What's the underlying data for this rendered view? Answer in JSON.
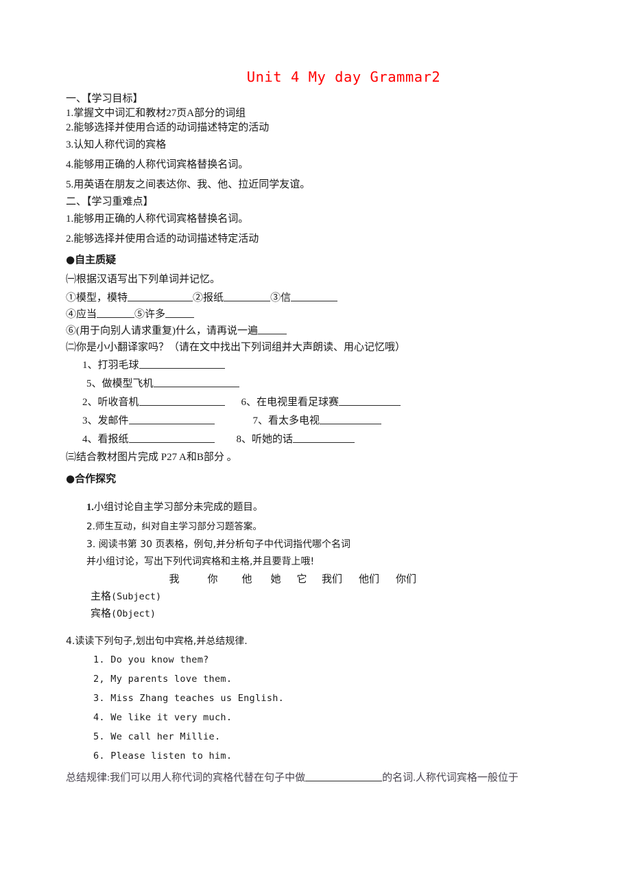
{
  "document": {
    "title": "Unit 4 My day Grammar2",
    "title_color": "#ff0000"
  },
  "section_objectives": {
    "heading": "一、【学习目标】",
    "items": [
      "1.掌握文中词汇和教材27页A部分的词组",
      "2.能够选择并使用合适的动词描述特定的活动",
      "3.认知人称代词的宾格",
      "4.能够用正确的人称代词宾格替换名词。",
      "5.用英语在朋友之间表达你、我、他、拉近同学友谊。"
    ]
  },
  "section_keypoints": {
    "heading": "二、【学习重难点】",
    "items": [
      "1.能够用正确的人称代词宾格替换名词。",
      "2.能够选择并使用合适的动词描述特定活动"
    ]
  },
  "section_selfquery": {
    "heading": "●自主质疑",
    "part1_label": "㈠根据汉语写出下列单词并记忆。",
    "part1_items": [
      {
        "num": "①",
        "text": "模型，模特",
        "blank": 95
      },
      {
        "num": "②",
        "text": "报纸",
        "blank": 68
      },
      {
        "num": "③",
        "text": "信",
        "blank": 68
      },
      {
        "num": "④",
        "text": "应当",
        "blank": 55
      },
      {
        "num": "⑤",
        "text": "许多",
        "blank": 42
      },
      {
        "num": "⑥",
        "text": "(用于向别人请求重复)什么，请再说一遍",
        "blank": 42
      }
    ],
    "part2_label": "㈡你是小小翻译家吗？（请在文中找出下列词组并大声朗读、用心记忆哦）",
    "part2_items": [
      {
        "num": "1、",
        "text": "打羽毛球",
        "blank": 125,
        "col": "left"
      },
      {
        "num": "5、",
        "text": "做模型飞机",
        "blank": 125,
        "col": "left"
      },
      {
        "num": "2、",
        "text": "听收音机",
        "blank": 125,
        "col": "left"
      },
      {
        "num": "6、",
        "text": "在电视里看足球赛",
        "blank": 90,
        "col": "right"
      },
      {
        "num": "3、",
        "text": "发邮件",
        "blank": 125,
        "col": "left"
      },
      {
        "num": "7、",
        "text": "看太多电视",
        "blank": 90,
        "col": "right"
      },
      {
        "num": "4、",
        "text": "看报纸",
        "blank": 125,
        "col": "left"
      },
      {
        "num": "8、",
        "text": "听她的话",
        "blank": 90,
        "col": "right"
      }
    ],
    "part3_label": "㈢结合教材图片完成 P27 A和B部分 。"
  },
  "section_cooperation": {
    "heading": "●合作探究",
    "item1_num": "1.",
    "item1_text": "小组讨论自主学习部分未完成的题目。",
    "item2_text": "2.师生互动，纠对自主学习部分习题答案。",
    "item3_line1": "3. 阅读书第 30 页表格，例句,并分析句子中代词指代哪个名词",
    "item3_line2": "并小组讨论，写出下列代词宾格和主格,并且要背上哦!",
    "pronoun_table": {
      "columns": [
        "我",
        "你",
        "他",
        "她",
        "它",
        "我们",
        "他们",
        "你们"
      ],
      "rows": [
        {
          "label_cn": "主格",
          "label_en": "(Subject)"
        },
        {
          "label_cn": "宾格",
          "label_en": "(Object)"
        }
      ]
    },
    "item4_text": "4.读读下列句子,划出句中宾格,并总结规律.",
    "sentences": [
      "1. Do you know them?",
      "2, My parents love them.",
      "3. Miss Zhang teaches us English.",
      "4. We like it very much.",
      "5. We call her Millie.",
      "6. Please listen to him."
    ],
    "summary_prefix": "总结规律:我们可以用人称代词的宾格代替在句子中做",
    "summary_blank": 112,
    "summary_suffix": "的名词.人称代词宾格一般位于"
  }
}
